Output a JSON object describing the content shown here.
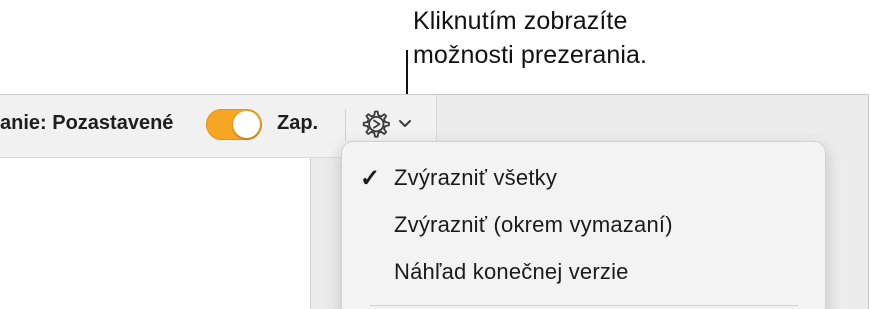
{
  "callout": {
    "text": "Kliknutím zobrazíte\nmožnosti prezerania."
  },
  "toolbar": {
    "tracking_label": "anie: Pozastavené",
    "tracking_toggle_on": true,
    "tracking_state_label": "Zap.",
    "view_button_icon": "gear-icon",
    "view_button_chevron": "chevron-down-icon"
  },
  "menu": {
    "items": [
      {
        "label": "Zvýrazniť všetky",
        "checked": true,
        "check_glyph": "✓"
      },
      {
        "label": "Zvýrazniť (okrem vymazaní)",
        "checked": false,
        "check_glyph": ""
      },
      {
        "label": "Náhľad konečnej verzie",
        "checked": false,
        "check_glyph": ""
      }
    ]
  },
  "colors": {
    "toggle_accent": "#f6a623",
    "toolbar_bg": "#f1f1f1",
    "menu_bg": "#f3f3f3"
  }
}
